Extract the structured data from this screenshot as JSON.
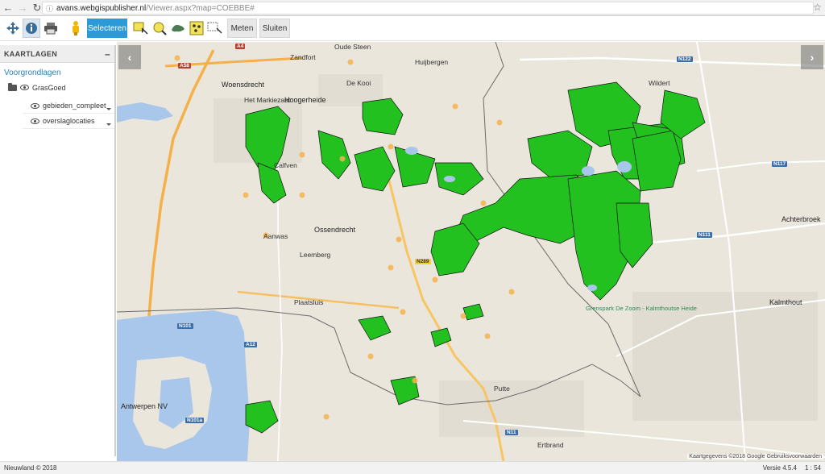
{
  "browser": {
    "url_host": "avans.webgispublisher.nl",
    "url_path": "/Viewer.aspx?map=COEBBE#"
  },
  "toolbar": {
    "select_label": "Selecteren",
    "measure_label": "Meten",
    "close_label": "Sluiten"
  },
  "sidebar": {
    "header": "KAARTLAGEN",
    "collapse": "–",
    "section": "Voorgrondlagen",
    "group": "GrasGoed",
    "layers": [
      {
        "label": "gebieden_compleet"
      },
      {
        "label": "overslaglocaties"
      }
    ]
  },
  "map": {
    "attribution": "Kaartgegevens ©2018 Google  Gebruiksvoorwaarden",
    "fill_color": "#22c11f",
    "towns": [
      "Zandfort",
      "Oude Steen",
      "Huijbergen",
      "Woensdrecht",
      "De Kooi",
      "Wildert",
      "Het Markiezaat",
      "Hoogerheide",
      "Calfven",
      "Ossendrecht",
      "Aanwas",
      "Leemberg",
      "Achterbroek",
      "Plaatsluis",
      "Kalmthout",
      "Putte",
      "Antwerpen NV",
      "Ertbrand",
      "Grenspark De Zoom - Kalmthoutse Heide"
    ],
    "roads": [
      "A58",
      "A4",
      "N289",
      "N122",
      "N117",
      "N111",
      "N101",
      "A12",
      "N101a",
      "N11"
    ]
  },
  "status": {
    "left": "Nieuwland © 2018",
    "version": "Versie 4.5.4",
    "scale": "1 : 54"
  }
}
